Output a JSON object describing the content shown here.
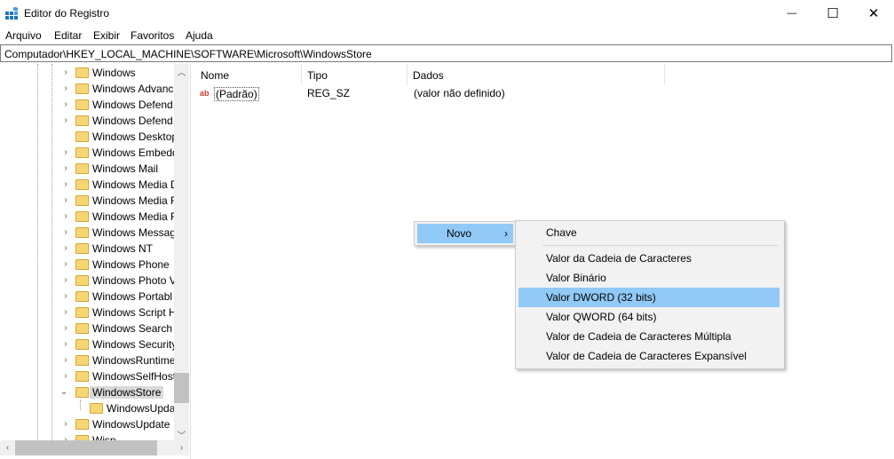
{
  "window": {
    "title": "Editor do Registro",
    "minimize_glyph": "—",
    "maximize_glyph": "☐",
    "close_glyph": "✕"
  },
  "menu": [
    "Arquivo",
    "Editar",
    "Exibir",
    "Favoritos",
    "Ajuda"
  ],
  "address": "Computador\\HKEY_LOCAL_MACHINE\\SOFTWARE\\Microsoft\\WindowsStore",
  "tree": {
    "items": [
      {
        "label": "Windows",
        "expander": "›"
      },
      {
        "label": "Windows Advanc",
        "expander": "›"
      },
      {
        "label": "Windows Defend",
        "expander": "›"
      },
      {
        "label": "Windows Defend",
        "expander": "›"
      },
      {
        "label": "Windows Desktop",
        "expander": ""
      },
      {
        "label": "Windows Embedd",
        "expander": "›"
      },
      {
        "label": "Windows Mail",
        "expander": "›"
      },
      {
        "label": "Windows Media D",
        "expander": "›"
      },
      {
        "label": "Windows Media F",
        "expander": "›"
      },
      {
        "label": "Windows Media F",
        "expander": "›"
      },
      {
        "label": "Windows Messag",
        "expander": "›"
      },
      {
        "label": "Windows NT",
        "expander": "›"
      },
      {
        "label": "Windows Phone",
        "expander": "›"
      },
      {
        "label": "Windows Photo V",
        "expander": "›"
      },
      {
        "label": "Windows Portabl",
        "expander": "›"
      },
      {
        "label": "Windows Script H",
        "expander": "›"
      },
      {
        "label": "Windows Search",
        "expander": "›"
      },
      {
        "label": "Windows Security",
        "expander": "›"
      },
      {
        "label": "WindowsRuntime",
        "expander": "›"
      },
      {
        "label": "WindowsSelfHost",
        "expander": "›"
      },
      {
        "label": "WindowsStore",
        "expander": "⌄"
      },
      {
        "label": "WindowsUpda",
        "expander": ""
      },
      {
        "label": "WindowsUpdate",
        "expander": "›"
      },
      {
        "label": "Wisp",
        "expander": "›"
      }
    ],
    "selected": "WindowsStore"
  },
  "list": {
    "columns": [
      "Nome",
      "Tipo",
      "Dados"
    ],
    "rows": [
      {
        "icon": "ab",
        "name": "(Padrão)",
        "type": "REG_SZ",
        "data": "(valor não definido)"
      }
    ]
  },
  "context_menu": {
    "parent_label": "Novo",
    "parent_arrow": "›",
    "submenu": [
      "Chave",
      "Valor da Cadeia de Caracteres",
      "Valor Binário",
      "Valor DWORD (32 bits)",
      "Valor QWORD (64 bits)",
      "Valor de Cadeia de Caracteres Múltipla",
      "Valor de Cadeia de Caracteres Expansível"
    ],
    "highlighted": "Valor DWORD (32 bits)"
  },
  "colors": {
    "highlight": "#91c9f7",
    "folder": "#f8d674",
    "tree_selected": "#d9d9d9"
  },
  "icons": {
    "app": "registry-editor-icon",
    "folder": "folder-icon",
    "string_value": "string-value-icon"
  }
}
